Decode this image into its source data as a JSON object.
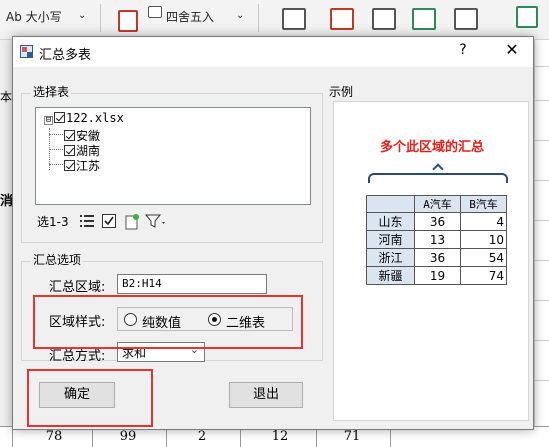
{
  "background": {
    "ribbon": {
      "case_label": "Ab 大小写",
      "round_label": "四舍五入",
      "dropdown_glyph": "⌄"
    },
    "left_strip": [
      "本",
      "消"
    ],
    "bottom_row": [
      "78",
      "99",
      "2",
      "12",
      "71"
    ]
  },
  "dialog": {
    "title": "汇总多表",
    "help": "?",
    "close": "✕",
    "select_group": {
      "label": "选择表",
      "tree": {
        "expander": "⊟",
        "root": "122.xlsx",
        "children": [
          "安徽",
          "湖南",
          "江苏"
        ]
      },
      "toolbar": {
        "selection_label": "选1-3"
      }
    },
    "options_group": {
      "label": "汇总选项",
      "region_label": "汇总区域:",
      "region_value": "B2:H14",
      "style_label": "区域样式:",
      "style_options": [
        "纯数值",
        "二维表"
      ],
      "style_selected": "二维表",
      "method_label": "汇总方式:",
      "method_value": "求和"
    },
    "ok_button": "确定",
    "exit_button": "退出",
    "example": {
      "label": "示例",
      "title": "多个此区域的汇总",
      "headers": [
        "A汽车",
        "B汽车"
      ],
      "rows": [
        {
          "name": "山东",
          "a": "36",
          "b": "4"
        },
        {
          "name": "河南",
          "a": "13",
          "b": "10"
        },
        {
          "name": "浙江",
          "a": "36",
          "b": "54"
        },
        {
          "name": "新疆",
          "a": "19",
          "b": "74"
        }
      ]
    }
  },
  "colors": {
    "highlight_red": "#e8322e",
    "example_title_red": "#e3221b",
    "dialog_bg": "#f0f0f0",
    "header_cell_blue": "#dbe5f1"
  }
}
